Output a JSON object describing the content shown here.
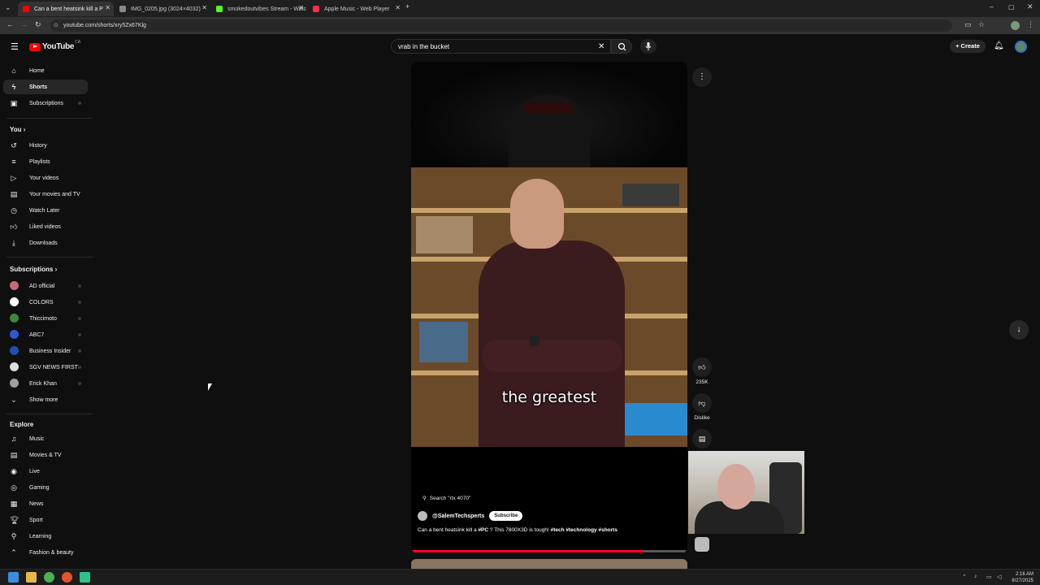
{
  "browser": {
    "tabs": [
      {
        "title": "Can a bent heatsink kill a P",
        "favicon_color": "#ff0000",
        "active": true
      },
      {
        "title": "IMG_0205.jpg (3024×4032)",
        "favicon_color": "#888888",
        "active": false
      },
      {
        "title": "smokedoutvibes Stream - Watc",
        "favicon_color": "#53fc18",
        "active": false
      },
      {
        "title": "Apple Music - Web Player",
        "favicon_color": "#fa2d48",
        "active": false
      }
    ],
    "new_tab": "+",
    "url": "youtube.com/shorts/xry5Zx67Klg",
    "window_controls": {
      "minimize": "–",
      "maximize": "▢",
      "close": "✕"
    }
  },
  "youtube": {
    "logo_text": "YouTube",
    "logo_country": "CA",
    "search_value": "vrab in the bucket",
    "create_label": "Create",
    "brand_color": "#ff0000"
  },
  "sidebar": {
    "main": [
      {
        "label": "Home",
        "icon": "home-icon"
      },
      {
        "label": "Shorts",
        "icon": "shorts-icon",
        "active": true
      },
      {
        "label": "Subscriptions",
        "icon": "subscriptions-icon"
      }
    ],
    "you_heading": "You",
    "you": [
      {
        "label": "History",
        "icon": "history-icon"
      },
      {
        "label": "Playlists",
        "icon": "playlists-icon"
      },
      {
        "label": "Your videos",
        "icon": "your-videos-icon"
      },
      {
        "label": "Your movies and TV",
        "icon": "movies-icon"
      },
      {
        "label": "Watch Later",
        "icon": "clock-icon"
      },
      {
        "label": "Liked videos",
        "icon": "thumbs-up-icon"
      },
      {
        "label": "Downloads",
        "icon": "download-icon"
      }
    ],
    "subscriptions_heading": "Subscriptions",
    "subscriptions": [
      {
        "label": "AD official",
        "color": "#c86a7a"
      },
      {
        "label": "COLORS",
        "color": "#ffffff"
      },
      {
        "label": "Thiccimoto",
        "color": "#3a8a3a"
      },
      {
        "label": "ABC7",
        "color": "#2a5ad0"
      },
      {
        "label": "Business Insider",
        "color": "#1f4fb0"
      },
      {
        "label": "SGV NEWS FIRST",
        "color": "#dddddd"
      },
      {
        "label": "Erick Khan",
        "color": "#9aa0a0"
      }
    ],
    "show_more": "Show more",
    "explore_heading": "Explore",
    "explore": [
      {
        "label": "Music",
        "icon": "music-icon"
      },
      {
        "label": "Movies & TV",
        "icon": "film-icon"
      },
      {
        "label": "Live",
        "icon": "live-icon"
      },
      {
        "label": "Gaming",
        "icon": "gaming-icon"
      },
      {
        "label": "News",
        "icon": "news-icon"
      },
      {
        "label": "Sport",
        "icon": "trophy-icon"
      },
      {
        "label": "Learning",
        "icon": "learning-icon"
      },
      {
        "label": "Fashion & beauty",
        "icon": "hanger-icon"
      }
    ]
  },
  "short": {
    "caption": "the greatest",
    "search_suggestion": "Search \"rtx 4070\"",
    "channel": "@SalemTechsperts",
    "subscribe_label": "Subscribe",
    "description_parts": [
      {
        "text": "Can a bent heatsink kill a ",
        "bold": false
      },
      {
        "text": "#PC",
        "bold": true
      },
      {
        "text": " ? This 7800X3D is tough! ",
        "bold": false
      },
      {
        "text": "#tech",
        "bold": true
      },
      {
        "text": " ",
        "bold": false
      },
      {
        "text": "#technology",
        "bold": true
      },
      {
        "text": " ",
        "bold": false
      },
      {
        "text": "#shorts",
        "bold": true
      }
    ],
    "progress": 0.84,
    "likes": "235K",
    "dislike_label": "Dislike"
  },
  "taskbar": {
    "time": "2:16 AM",
    "date": "8/27/2025"
  }
}
